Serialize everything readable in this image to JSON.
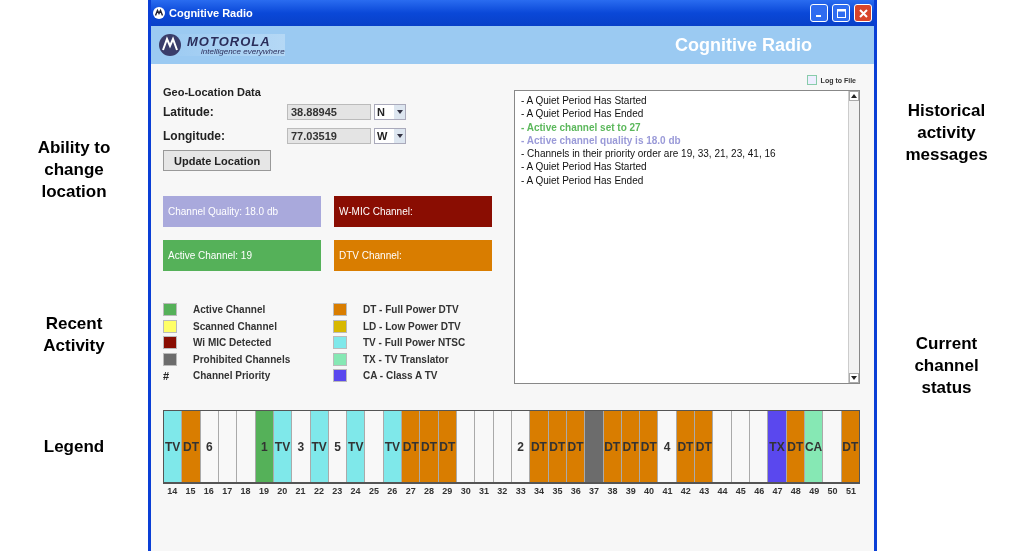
{
  "annotations_left": [
    {
      "text": "Ability to change location",
      "kind": "top"
    },
    {
      "text": "Recent Activity",
      "kind": "mid"
    },
    {
      "text": "Legend",
      "kind": "low"
    }
  ],
  "annotations_right": [
    {
      "text": "Historical activity messages",
      "kind": "top"
    },
    {
      "text": "Current channel status",
      "kind": "mid"
    }
  ],
  "window": {
    "title": "Cognitive Radio"
  },
  "header": {
    "brand": "MOTOROLA",
    "tagline": "intelligence everywhere",
    "app_title": "Cognitive Radio"
  },
  "geo": {
    "heading": "Geo-Location Data",
    "latitude": {
      "label": "Latitude:",
      "value": "38.88945",
      "direction": "N"
    },
    "longitude": {
      "label": "Longitude:",
      "value": "77.03519",
      "direction": "W"
    },
    "button": "Update Location"
  },
  "status_boxes": [
    {
      "text": "Channel Quality: 18.0 db",
      "color": "#a9a9dc"
    },
    {
      "text": "W-MIC Channel:",
      "color": "#8a0d02"
    },
    {
      "text": "Active Channel: 19",
      "color": "#55b159"
    },
    {
      "text": "DTV Channel:",
      "color": "#d97d00"
    }
  ],
  "log_to_file": {
    "label": "Log to File",
    "checked": false
  },
  "log": [
    {
      "text": "- A Quiet Period Has Started",
      "kind": "event"
    },
    {
      "text": "- A Quiet Period Has Ended",
      "kind": "event"
    },
    {
      "text": "- Active channel set to 27",
      "kind": "highlight",
      "color": "#5cb85c"
    },
    {
      "text": "- Active channel quality is 18.0 db",
      "kind": "highlight",
      "color": "#9a9ad8"
    },
    {
      "text": "- Channels in their priority order are 19, 33, 21, 23, 41, 16",
      "kind": "event"
    },
    {
      "text": "- A Quiet Period Has Started",
      "kind": "event"
    },
    {
      "text": "- A Quiet Period Has Ended",
      "kind": "event"
    }
  ],
  "legend": [
    {
      "kind": "swatch",
      "color": "#55b159",
      "label": "Active Channel"
    },
    {
      "kind": "swatch",
      "color": "#d97d00",
      "label": "DT - Full Power DTV"
    },
    {
      "kind": "swatch",
      "color": "#ffff66",
      "label": "Scanned Channel"
    },
    {
      "kind": "swatch",
      "color": "#d8b800",
      "label": "LD - Low Power DTV"
    },
    {
      "kind": "swatch",
      "color": "#8a0d02",
      "label": "Wi MIC Detected"
    },
    {
      "kind": "swatch",
      "color": "#7fe8ea",
      "label": "TV - Full Power NTSC"
    },
    {
      "kind": "swatch",
      "color": "#6c6c6c",
      "label": "Prohibited Channels"
    },
    {
      "kind": "swatch",
      "color": "#86e8b4",
      "label": "TX - TV Translator"
    },
    {
      "kind": "symbol",
      "symbol": "#",
      "label": "Channel Priority"
    },
    {
      "kind": "swatch",
      "color": "#5a48ee",
      "label": "CA - Class A TV"
    }
  ],
  "channels": [
    {
      "number": "14",
      "label": "TV",
      "color": "#7fe8ea"
    },
    {
      "number": "15",
      "label": "DT",
      "color": "#d97d00"
    },
    {
      "number": "16",
      "label": "6"
    },
    {
      "number": "17"
    },
    {
      "number": "18"
    },
    {
      "number": "19",
      "label": "1",
      "color": "#55b159"
    },
    {
      "number": "20",
      "label": "TV",
      "color": "#7fe8ea"
    },
    {
      "number": "21",
      "label": "3"
    },
    {
      "number": "22",
      "label": "TV",
      "color": "#7fe8ea"
    },
    {
      "number": "23",
      "label": "5"
    },
    {
      "number": "24",
      "label": "TV",
      "color": "#7fe8ea"
    },
    {
      "number": "25"
    },
    {
      "number": "26",
      "label": "TV",
      "color": "#7fe8ea"
    },
    {
      "number": "27",
      "label": "DT",
      "color": "#d97d00"
    },
    {
      "number": "28",
      "label": "DT",
      "color": "#d97d00"
    },
    {
      "number": "29",
      "label": "DT",
      "color": "#d97d00"
    },
    {
      "number": "30"
    },
    {
      "number": "31"
    },
    {
      "number": "32"
    },
    {
      "number": "33",
      "label": "2"
    },
    {
      "number": "34",
      "label": "DT",
      "color": "#d97d00"
    },
    {
      "number": "35",
      "label": "DT",
      "color": "#d97d00"
    },
    {
      "number": "36",
      "label": "DT",
      "color": "#d97d00"
    },
    {
      "number": "37",
      "color": "#6c6c6c"
    },
    {
      "number": "38",
      "label": "DT",
      "color": "#d97d00"
    },
    {
      "number": "39",
      "label": "DT",
      "color": "#d97d00"
    },
    {
      "number": "40",
      "label": "DT",
      "color": "#d97d00"
    },
    {
      "number": "41",
      "label": "4"
    },
    {
      "number": "42",
      "label": "DT",
      "color": "#d97d00"
    },
    {
      "number": "43",
      "label": "DT",
      "color": "#d97d00"
    },
    {
      "number": "44"
    },
    {
      "number": "45"
    },
    {
      "number": "46"
    },
    {
      "number": "47",
      "label": "TX",
      "color": "#5a48ee"
    },
    {
      "number": "48",
      "label": "DT",
      "color": "#d97d00"
    },
    {
      "number": "49",
      "label": "CA",
      "color": "#86e8b4"
    },
    {
      "number": "50"
    },
    {
      "number": "51",
      "label": "DT",
      "color": "#d97d00"
    }
  ]
}
